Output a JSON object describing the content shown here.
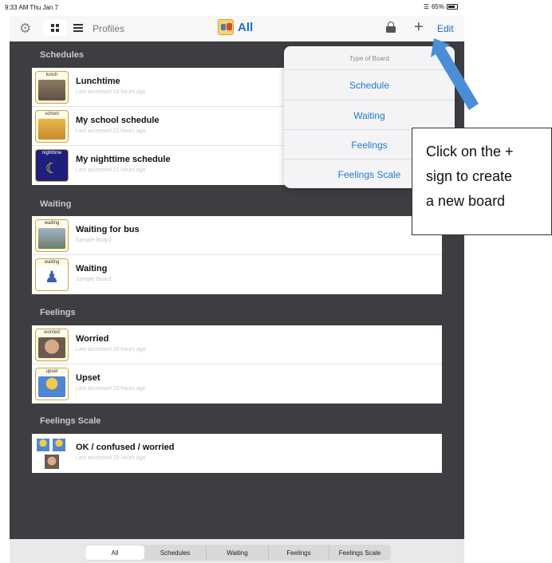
{
  "status_bar": {
    "time_date": "9:33 AM  Thu Jan 7",
    "battery": "65%"
  },
  "nav": {
    "profiles_label": "Profiles",
    "title": "All",
    "edit_label": "Edit",
    "add_symbol": "+"
  },
  "sections": [
    {
      "header": "Schedules",
      "rows": [
        {
          "thumb_label": "lunch",
          "title": "Lunchtime",
          "subtitle": "Last accessed 19 hours ago"
        },
        {
          "thumb_label": "school",
          "title": "My school schedule",
          "subtitle": "Last accessed 21 hours ago"
        },
        {
          "thumb_label": "nighttime",
          "title": "My nighttime schedule",
          "subtitle": "Last accessed 21 hours ago"
        }
      ]
    },
    {
      "header": "Waiting",
      "rows": [
        {
          "thumb_label": "waiting",
          "title": "Waiting for bus",
          "subtitle": "Sample Board"
        },
        {
          "thumb_label": "waiting",
          "title": "Waiting",
          "subtitle": "Sample Board"
        }
      ]
    },
    {
      "header": "Feelings",
      "rows": [
        {
          "thumb_label": "worried",
          "title": "Worried",
          "subtitle": "Last accessed 20 hours ago"
        },
        {
          "thumb_label": "upset",
          "title": "Upset",
          "subtitle": "Last accessed 20 hours ago"
        }
      ]
    },
    {
      "header": "Feelings Scale",
      "rows": [
        {
          "thumb_label": "",
          "title": "OK / confused / worried",
          "subtitle": "Last accessed 20 hours ago"
        }
      ]
    }
  ],
  "popover": {
    "header": "Type of Board",
    "items": [
      "Schedule",
      "Waiting",
      "Feelings",
      "Feelings Scale"
    ]
  },
  "callout": {
    "lines": [
      "Click on the +",
      "sign to create",
      "a new board"
    ]
  },
  "bottom_tabs": [
    "All",
    "Schedules",
    "Waiting",
    "Feelings",
    "Feelings Scale"
  ],
  "colors": {
    "accent": "#1f7ad0",
    "panel": "#3e3e42",
    "thumb_border": "#c9a642",
    "arrow": "#4a8fd6"
  }
}
